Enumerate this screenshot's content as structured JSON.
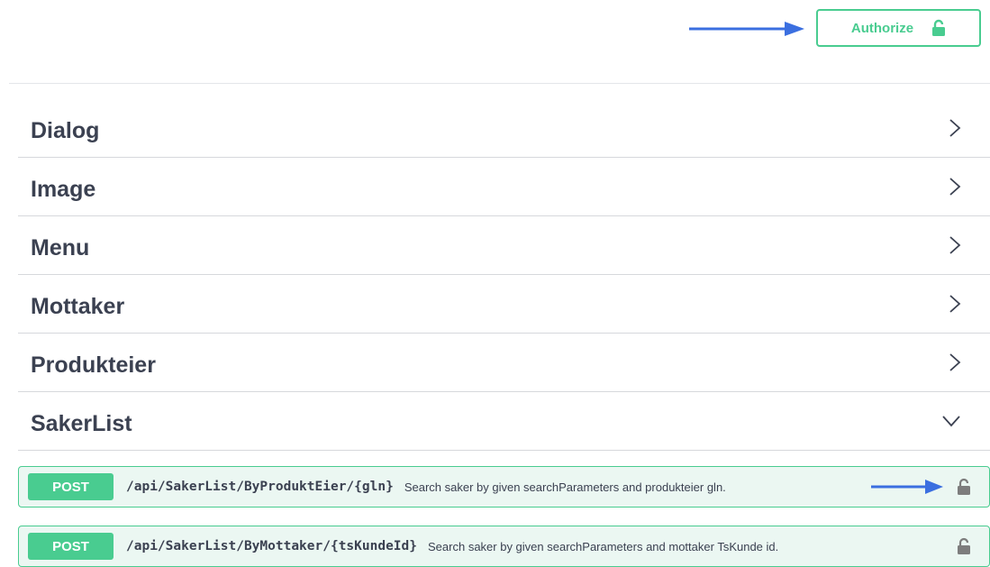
{
  "header": {
    "authorize_label": "Authorize",
    "authorize_icon": "lock-icon",
    "accent_color": "#49cc90",
    "annotation_arrow_color": "#3b6fe0"
  },
  "tags": [
    {
      "name": "Dialog",
      "state": "collapsed",
      "icon": "chevron-right-icon"
    },
    {
      "name": "Image",
      "state": "collapsed",
      "icon": "chevron-right-icon"
    },
    {
      "name": "Menu",
      "state": "collapsed",
      "icon": "chevron-right-icon"
    },
    {
      "name": "Mottaker",
      "state": "collapsed",
      "icon": "chevron-right-icon"
    },
    {
      "name": "Produkteier",
      "state": "collapsed",
      "icon": "chevron-right-icon"
    },
    {
      "name": "SakerList",
      "state": "expanded",
      "icon": "chevron-down-icon"
    }
  ],
  "operations": [
    {
      "method": "POST",
      "path": "/api/SakerList/ByProduktEier/{gln}",
      "summary": "Search saker by given searchParameters and produkteier gln.",
      "icon": "lock-icon"
    },
    {
      "method": "POST",
      "path": "/api/SakerList/ByMottaker/{tsKundeId}",
      "summary": "Search saker by given searchParameters and mottaker TsKunde id.",
      "icon": "lock-icon"
    }
  ]
}
